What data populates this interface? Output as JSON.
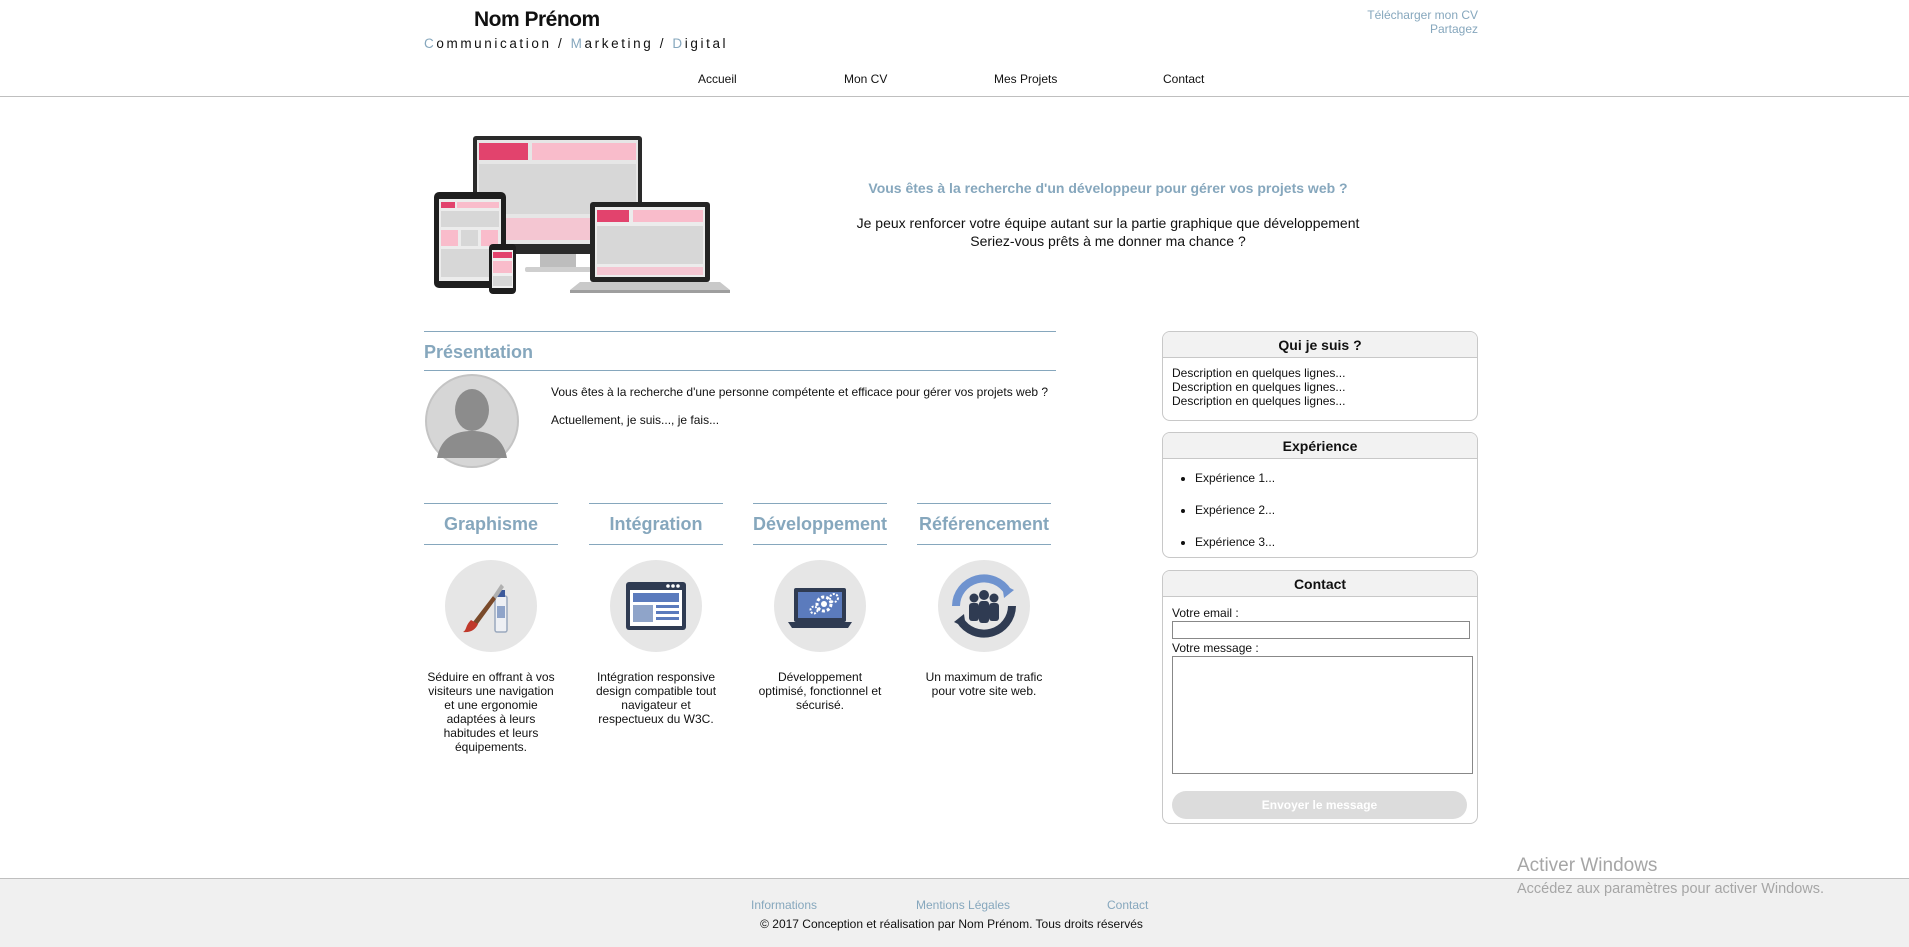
{
  "header": {
    "name": "Nom Prénom",
    "tagline_parts": [
      {
        "initial": "C",
        "rest": "ommunication"
      },
      {
        "initial": "M",
        "rest": "arketing"
      },
      {
        "initial": "D",
        "rest": "igital"
      }
    ],
    "tagline_separator": " / ",
    "download_cv": "Télécharger mon CV",
    "share": "Partagez"
  },
  "nav": {
    "items": [
      {
        "label": "Accueil"
      },
      {
        "label": "Mon CV"
      },
      {
        "label": "Mes Projets"
      },
      {
        "label": "Contact"
      }
    ]
  },
  "hero": {
    "question": "Vous êtes à la recherche d'un développeur pour gérer vos projets web ?",
    "line1": "Je peux renforcer votre équipe autant sur la partie graphique que développement",
    "line2": "Seriez-vous prêts à me donner ma chance ?"
  },
  "presentation": {
    "title": "Présentation",
    "paragraph1": "Vous êtes à la recherche d'une personne compétente et efficace pour gérer vos projets web ?",
    "paragraph2": "Actuellement, je suis..., je fais..."
  },
  "services": [
    {
      "title": "Graphisme",
      "icon": "paintbrush-icon",
      "text": "Séduire en offrant à vos visiteurs une navigation et une ergonomie adaptées à leurs habitudes et leurs équipements."
    },
    {
      "title": "Intégration",
      "icon": "browser-window-icon",
      "text": "Intégration responsive design compatible tout navigateur et respectueux du W3C."
    },
    {
      "title": "Développement",
      "icon": "laptop-gears-icon",
      "text": "Développement optimisé, fonctionnel et sécurisé."
    },
    {
      "title": "Référencement",
      "icon": "people-cycle-icon",
      "text": "Un maximum de trafic pour votre site web."
    }
  ],
  "sidebar": {
    "about": {
      "title": "Qui je suis ?",
      "lines": [
        "Description en quelques lignes...",
        "Description en quelques lignes...",
        "Description en quelques lignes..."
      ]
    },
    "experience": {
      "title": "Expérience",
      "items": [
        "Expérience 1...",
        "Expérience 2...",
        "Expérience 3..."
      ]
    },
    "contact": {
      "title": "Contact",
      "email_label": "Votre email :",
      "email_value": "",
      "message_label": "Votre message :",
      "message_value": "",
      "submit_label": "Envoyer le message"
    }
  },
  "footer": {
    "links": [
      {
        "label": "Informations"
      },
      {
        "label": "Mentions Légales"
      },
      {
        "label": "Contact"
      }
    ],
    "copyright": "© 2017 Conception et réalisation par Nom Prénom. Tous droits réservés"
  },
  "watermark": {
    "title": "Activer Windows",
    "subtitle": "Accédez aux paramètres pour activer Windows."
  },
  "colors": {
    "accent": "#86a7bd",
    "hero_pink_dark": "#e2436d",
    "hero_pink_light": "#f9bccb",
    "footer_bg": "#f0f0f0",
    "button_disabled": "#dcdcdc"
  }
}
